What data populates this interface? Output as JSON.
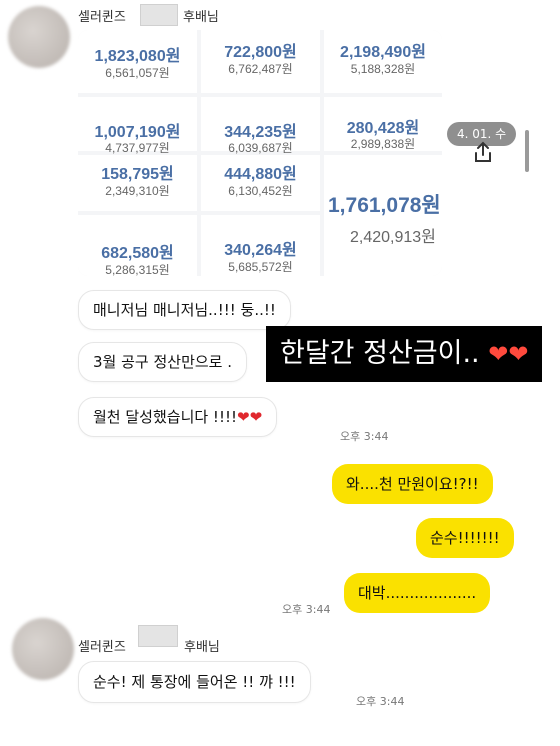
{
  "sender_top": {
    "name": "셀러퀸즈",
    "suffix": "후배님"
  },
  "sender_bottom": {
    "name": "셀러퀸즈",
    "suffix": "후배님"
  },
  "sales_cells": [
    {
      "amount": "1,823,080원",
      "sub": "6,561,057원"
    },
    {
      "amount": "722,800원",
      "sub": "6,762,487원"
    },
    {
      "amount": "2,198,490원",
      "sub": "5,188,328원"
    },
    {
      "amount": "1,007,190원",
      "sub": "4,737,977원"
    },
    {
      "amount": "344,235원",
      "sub": "6,039,687원"
    },
    {
      "amount": "280,428원",
      "sub": "2,989,838원"
    },
    {
      "amount": "158,795원",
      "sub": "2,349,310원"
    },
    {
      "amount": "444,880원",
      "sub": "6,130,452원"
    },
    {
      "amount": "1,761,078원",
      "sub": "2,420,913원"
    },
    {
      "amount": "682,580원",
      "sub": "5,286,315원"
    },
    {
      "amount": "340,264원",
      "sub": "5,685,572원"
    }
  ],
  "date_pill": "4. 01. 수",
  "icons": {
    "share": "share-upload-icon",
    "heart": "red-heart-icon",
    "fire_heart": "heart-on-fire-icon"
  },
  "messages_in": [
    {
      "text": "매니저님 매니저님..!!! 둥..!!"
    },
    {
      "text": "3월 공구 정산만으로 ."
    },
    {
      "text": "월천 달성했습니다 !!!!"
    }
  ],
  "time_in_1": "오후 3:44",
  "caption": "한달간 정산금이..",
  "messages_out": [
    {
      "text": "와....천 만원이요!?!!"
    },
    {
      "text": "순수!!!!!!!"
    },
    {
      "text": "대박..................."
    }
  ],
  "time_out": "오후 3:44",
  "message_last": "순수! 제 통장에 들어온 !! 꺄 !!!",
  "time_last": "오후 3:44",
  "colors": {
    "kakao_yellow": "#fae100",
    "amount_blue": "#4a6fa5",
    "caption_bg": "#000000"
  }
}
